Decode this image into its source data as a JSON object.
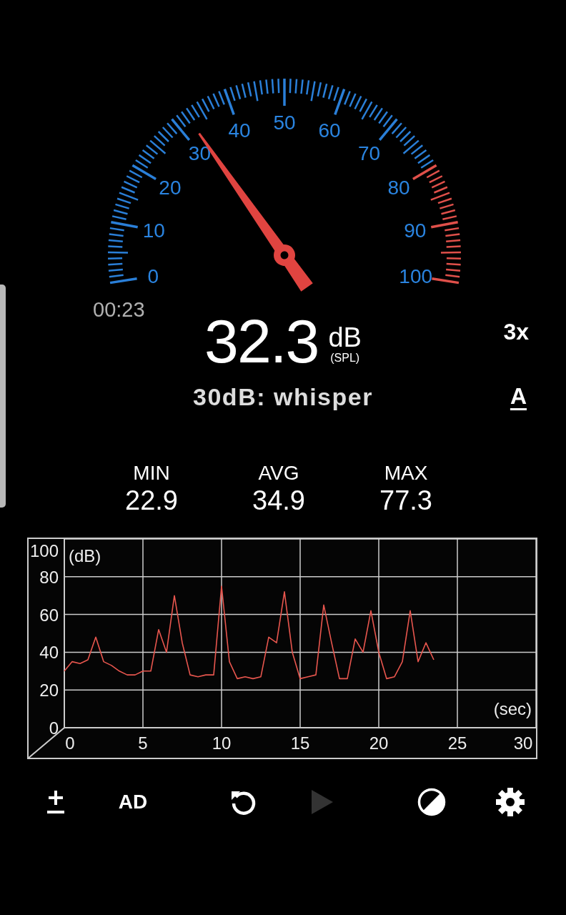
{
  "gauge": {
    "labels": [
      "0",
      "10",
      "20",
      "30",
      "40",
      "50",
      "60",
      "70",
      "80",
      "90",
      "100"
    ]
  },
  "timer": "00:23",
  "reading": {
    "value": "32.3",
    "unit": "dB",
    "weighting_note": "(SPL)",
    "description": "30dB: whisper"
  },
  "side_controls": [
    {
      "kind": "zoom",
      "label": "3x"
    },
    {
      "kind": "weighting",
      "label": "A"
    }
  ],
  "stats": [
    {
      "label": "MIN",
      "value": "22.9"
    },
    {
      "label": "AVG",
      "value": "34.9"
    },
    {
      "label": "MAX",
      "value": "77.3"
    }
  ],
  "chart": {
    "chart_data": {
      "type": "line",
      "grid": true,
      "xlabel": "(sec)",
      "ylabel": "(dB)",
      "xlim": [
        0,
        30
      ],
      "ylim": [
        0,
        100
      ],
      "xticks": [
        0,
        5,
        10,
        15,
        20,
        25,
        30
      ],
      "yticks": [
        0,
        20,
        40,
        60,
        80,
        100
      ],
      "x": [
        0,
        0.5,
        1,
        1.5,
        2,
        2.5,
        3,
        3.5,
        4,
        4.5,
        5,
        5.5,
        6,
        6.5,
        7,
        7.5,
        8,
        8.5,
        9,
        9.5,
        10,
        10.5,
        11,
        11.5,
        12,
        12.5,
        13,
        13.5,
        14,
        14.5,
        15,
        15.5,
        16,
        16.5,
        17,
        17.5,
        18,
        18.5,
        19,
        19.5,
        20,
        20.5,
        21,
        21.5,
        22,
        22.5,
        23,
        23.5
      ],
      "series": [
        {
          "color": "#e8564e",
          "values": [
            30,
            35,
            34,
            36,
            48,
            35,
            33,
            30,
            28,
            28,
            30,
            30,
            52,
            40,
            70,
            45,
            28,
            27,
            28,
            28,
            75,
            35,
            26,
            27,
            26,
            27,
            48,
            45,
            72,
            40,
            26,
            27,
            28,
            65,
            45,
            26,
            26,
            47,
            40,
            62,
            40,
            26,
            27,
            35,
            62,
            35,
            45,
            36
          ]
        }
      ]
    }
  },
  "toolbar": [
    {
      "kind": "plusminus",
      "disabled": false
    },
    {
      "kind": "ad",
      "label": "AD",
      "disabled": false
    },
    {
      "kind": "reset",
      "disabled": false
    },
    {
      "kind": "play",
      "disabled": true
    },
    {
      "kind": "contrast",
      "disabled": false
    },
    {
      "kind": "settings",
      "disabled": false
    }
  ]
}
